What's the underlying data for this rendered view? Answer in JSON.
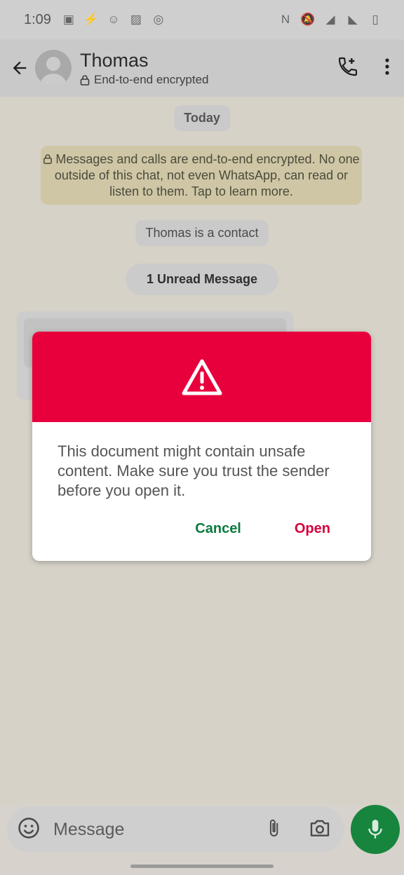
{
  "status_bar": {
    "time": "1:09"
  },
  "header": {
    "contact_name": "Thomas",
    "subtitle": "End-to-end encrypted"
  },
  "chat": {
    "date_label": "Today",
    "encryption_notice": "Messages and calls are end-to-end encrypted. No one outside of this chat, not even WhatsApp, can read or listen to them. Tap to learn more.",
    "contact_notice": "Thomas is a contact",
    "unread_label": "1 Unread Message"
  },
  "dialog": {
    "message": "This document might contain unsafe content. Make sure you trust the sender before you open it.",
    "cancel_label": "Cancel",
    "open_label": "Open"
  },
  "composer": {
    "placeholder": "Message"
  },
  "colors": {
    "dialog_header": "#e8003d",
    "cancel_text": "#0c7a3e",
    "open_text": "#d6003c",
    "mic_button": "#17853e"
  },
  "icons": [
    "back-arrow-icon",
    "avatar-icon",
    "lock-icon",
    "add-call-icon",
    "more-vert-icon",
    "warning-icon",
    "emoji-icon",
    "attach-icon",
    "camera-icon",
    "mic-icon"
  ]
}
